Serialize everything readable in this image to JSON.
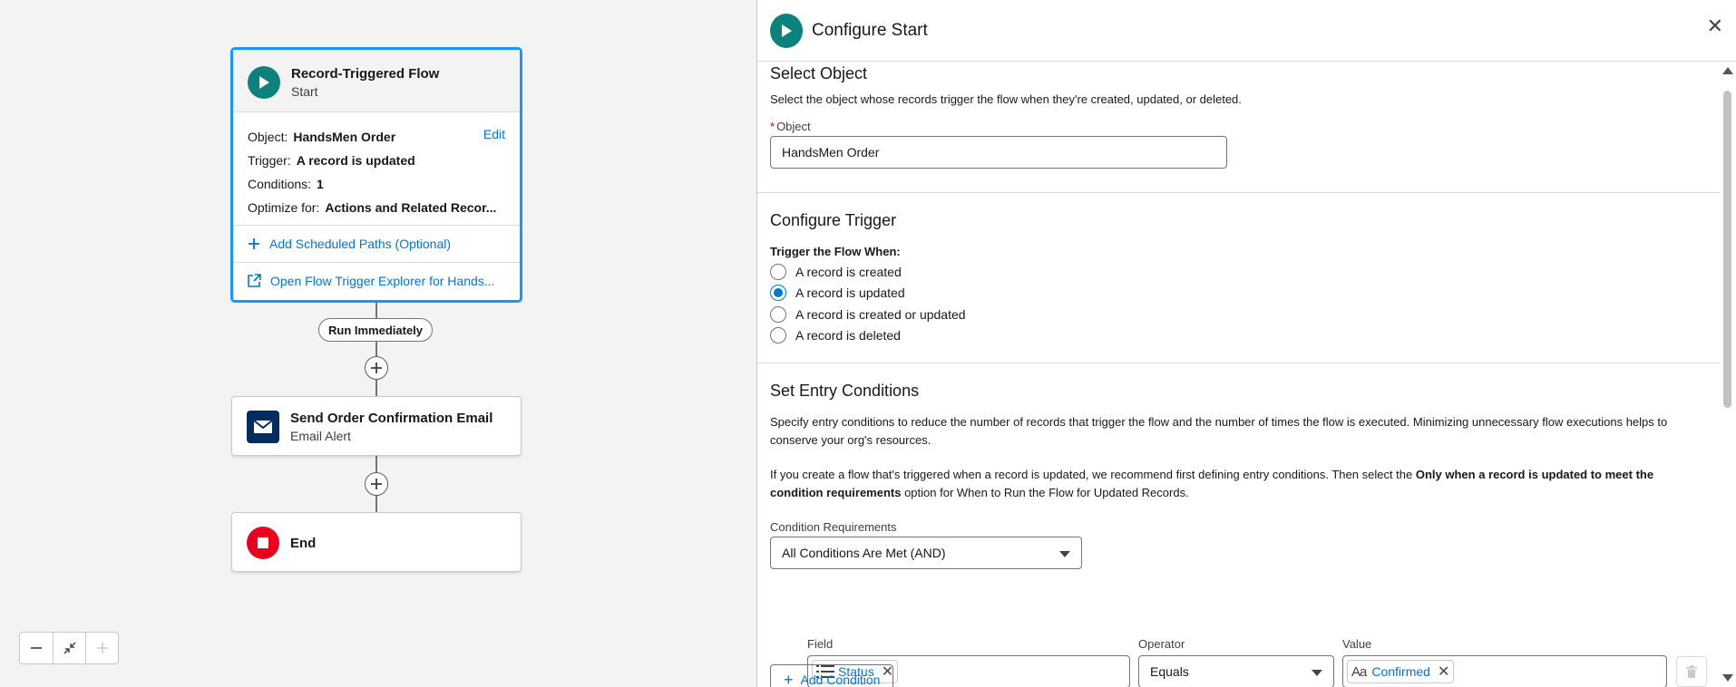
{
  "canvas": {
    "start_node": {
      "title": "Record-Triggered Flow",
      "subtitle": "Start",
      "object_label": "Object:",
      "object_value": "HandsMen Order",
      "edit_label": "Edit",
      "trigger_label": "Trigger:",
      "trigger_value": "A record is updated",
      "conditions_label": "Conditions:",
      "conditions_value": "1",
      "optimize_label": "Optimize for:",
      "optimize_value": "Actions and Related Recor...",
      "add_scheduled_paths": "Add Scheduled Paths (Optional)",
      "open_trigger_explorer": "Open Flow Trigger Explorer for Hands..."
    },
    "run_immediately": "Run Immediately",
    "email_node": {
      "title": "Send Order Confirmation Email",
      "subtitle": "Email Alert"
    },
    "end_node": {
      "title": "End"
    }
  },
  "panel": {
    "title": "Configure Start",
    "select_object": {
      "title": "Select Object",
      "description": "Select the object whose records trigger the flow when they're created, updated, or deleted.",
      "required_mark": "*",
      "field_label": "Object",
      "field_value": "HandsMen Order"
    },
    "configure_trigger": {
      "title": "Configure Trigger",
      "question": "Trigger the Flow When:",
      "options": [
        {
          "label": "A record is created",
          "checked": false
        },
        {
          "label": "A record is updated",
          "checked": true
        },
        {
          "label": "A record is created or updated",
          "checked": false
        },
        {
          "label": "A record is deleted",
          "checked": false
        }
      ]
    },
    "entry_conditions": {
      "title": "Set Entry Conditions",
      "description": "Specify entry conditions to reduce the number of records that trigger the flow and the number of times the flow is executed. Minimizing unnecessary flow executions helps to conserve your org's resources.",
      "note_part1": "If you create a flow that's triggered when a record is updated, we recommend first defining entry conditions. Then select the ",
      "note_bold": "Only when a record is updated to meet the condition requirements",
      "note_part2": " option for When to Run the Flow for Updated Records.",
      "requirements_label": "Condition Requirements",
      "requirements_value": "All Conditions Are Met (AND)",
      "field_header": "Field",
      "operator_header": "Operator",
      "value_header": "Value",
      "condition": {
        "field": "Status",
        "operator": "Equals",
        "value": "Confirmed"
      },
      "add_condition": "Add Condition"
    }
  },
  "colors": {
    "brand_blue": "#0176d3",
    "start_teal": "#0b827c",
    "email_navy": "#032d60",
    "end_red": "#ea001e"
  }
}
